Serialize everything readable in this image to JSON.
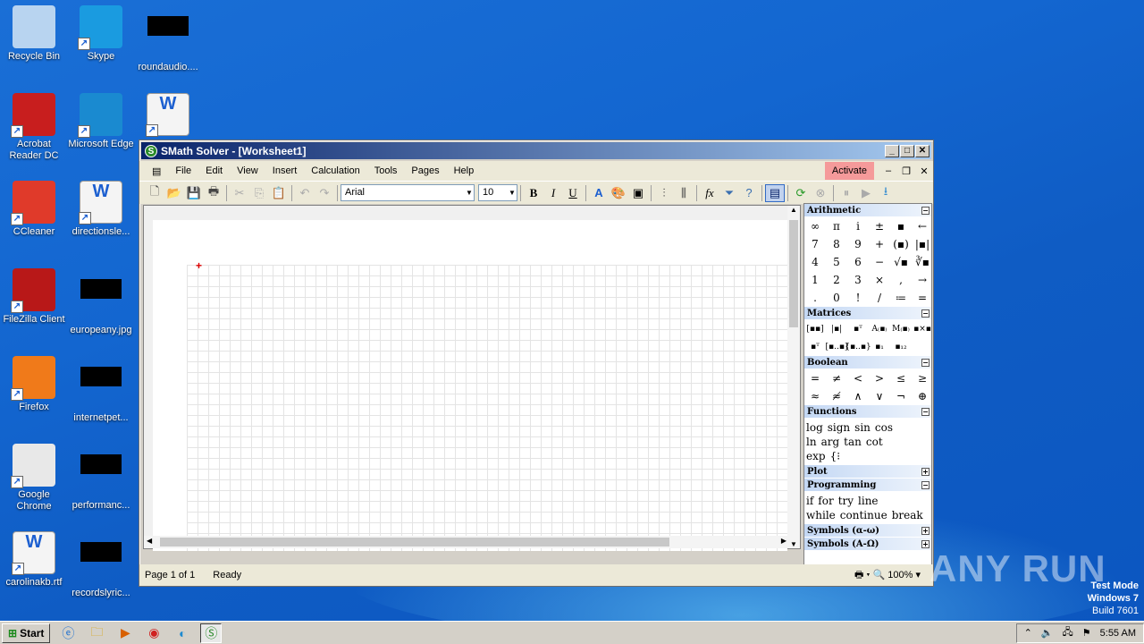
{
  "desktop_icons": [
    {
      "label": "Recycle Bin",
      "icon": "recycle-bin-icon"
    },
    {
      "label": "Skype",
      "icon": "skype-icon"
    },
    {
      "label": "roundaudio....",
      "icon": "file-icon"
    },
    {
      "label": "Acrobat Reader DC",
      "icon": "acrobat-icon"
    },
    {
      "label": "Microsoft Edge",
      "icon": "edge-icon"
    },
    {
      "label": "",
      "icon": "word-doc-icon"
    },
    {
      "label": "CCleaner",
      "icon": "ccleaner-icon"
    },
    {
      "label": "directionsle...",
      "icon": "word-doc-icon"
    },
    {
      "label": "FileZilla Client",
      "icon": "filezilla-icon"
    },
    {
      "label": "europeany.jpg",
      "icon": "image-icon"
    },
    {
      "label": "Firefox",
      "icon": "firefox-icon"
    },
    {
      "label": "internetpet...",
      "icon": "file-icon"
    },
    {
      "label": "Google Chrome",
      "icon": "chrome-icon"
    },
    {
      "label": "performanc...",
      "icon": "file-icon"
    },
    {
      "label": "carolinakb.rtf",
      "icon": "word-doc-icon"
    },
    {
      "label": "recordslyric...",
      "icon": "file-icon"
    }
  ],
  "window": {
    "title": "SMath Solver - [Worksheet1]",
    "menu": [
      "File",
      "Edit",
      "View",
      "Insert",
      "Calculation",
      "Tools",
      "Pages",
      "Help"
    ],
    "activate_label": "Activate",
    "font_name": "Arial",
    "font_size": "10",
    "cursor_symbol": "+",
    "status_page": "Page 1 of 1",
    "status_text": "Ready",
    "zoom": "100%"
  },
  "panel": {
    "arithmetic_title": "Arithmetic",
    "arithmetic": [
      "∞",
      "π",
      "i",
      "±",
      "▪",
      "←",
      "7",
      "8",
      "9",
      "+",
      "(▪)",
      "|▪|",
      "4",
      "5",
      "6",
      "−",
      "√▪",
      "∛▪",
      "1",
      "2",
      "3",
      "×",
      ",",
      "→",
      ".",
      "0",
      "!",
      "/",
      "≔",
      "="
    ],
    "matrices_title": "Matrices",
    "matrices": [
      "[▪▪]",
      "|▪|",
      "▪ᵀ",
      "A₍▪₎",
      "M₍▪₎",
      "▪×▪",
      "▪ᵀ",
      "[▪..▪]",
      "{▪..▪}",
      "▪₁",
      "▪₁₂",
      ""
    ],
    "boolean_title": "Boolean",
    "boolean": [
      "=",
      "≠",
      "<",
      ">",
      "≤",
      "≥",
      "≈",
      "≉",
      "∧",
      "∨",
      "¬",
      "⊕"
    ],
    "functions_title": "Functions",
    "functions_row1": [
      "log",
      "sign",
      "sin",
      "cos"
    ],
    "functions_row2": [
      "ln",
      "arg",
      "tan",
      "cot"
    ],
    "functions_row3": [
      "exp",
      "{⁝"
    ],
    "plot_title": "Plot",
    "programming_title": "Programming",
    "programming_row1": [
      "if",
      "for",
      "try",
      "line"
    ],
    "programming_row2": [
      "while",
      "continue",
      "break"
    ],
    "symbols_greek_lower": "Symbols (α-ω)",
    "symbols_greek_upper": "Symbols (Α-Ω)"
  },
  "taskbar": {
    "start": "Start",
    "clock": "5:55 AM"
  },
  "watermark": "ANY RUN",
  "testmode": {
    "line1": "Test Mode",
    "line2": "Windows 7",
    "line3": "Build 7601"
  }
}
